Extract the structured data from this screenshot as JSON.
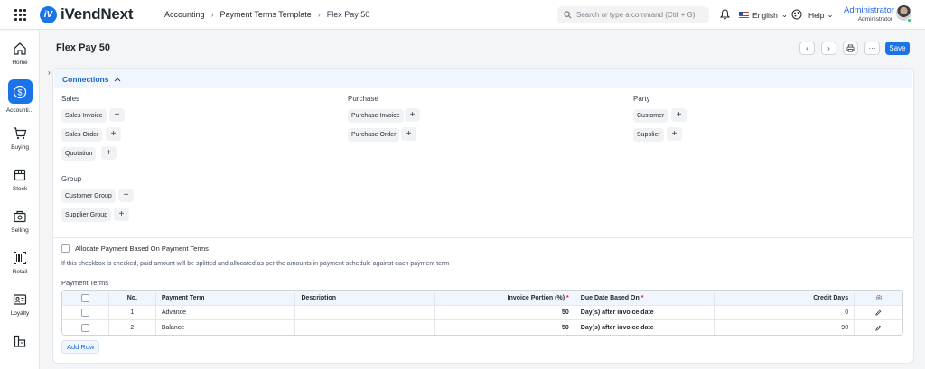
{
  "app": {
    "logo_mark": "iV",
    "name": "iVendNext"
  },
  "breadcrumb": [
    "Accounting",
    "Payment Terms Template",
    "Flex Pay 50"
  ],
  "search": {
    "placeholder": "Search or type a command (Ctrl + G)"
  },
  "language": "English",
  "help": "Help",
  "user": {
    "name": "Administrator",
    "role": "Administrator"
  },
  "sidebar": {
    "items": [
      {
        "label": "Home",
        "icon": "home-icon"
      },
      {
        "label": "Accounti...",
        "icon": "dollar-icon",
        "active": true
      },
      {
        "label": "Buying",
        "icon": "cart-icon"
      },
      {
        "label": "Stock",
        "icon": "box-icon"
      },
      {
        "label": "Selling",
        "icon": "selling-icon"
      },
      {
        "label": "Retail",
        "icon": "barcode-icon"
      },
      {
        "label": "Loyalty",
        "icon": "id-card-icon"
      },
      {
        "label": "",
        "icon": "building-icon"
      }
    ]
  },
  "page": {
    "title": "Flex Pay 50",
    "save_label": "Save",
    "more_label": "···"
  },
  "connections": {
    "title": "Connections",
    "groups": [
      {
        "label": "Sales",
        "items": [
          "Sales Invoice",
          "Sales Order",
          "Quotation"
        ]
      },
      {
        "label": "Purchase",
        "items": [
          "Purchase Invoice",
          "Purchase Order"
        ]
      },
      {
        "label": "Party",
        "items": [
          "Customer",
          "Supplier"
        ]
      },
      {
        "label": "Group",
        "items": [
          "Customer Group",
          "Supplier Group"
        ]
      }
    ]
  },
  "allocate": {
    "label": "Allocate Payment Based On Payment Terms",
    "description": "If this checkbox is checked, paid amount will be splitted and allocated as per the amounts in payment schedule against each payment term"
  },
  "payment_terms": {
    "label": "Payment Terms",
    "columns": [
      "No.",
      "Payment Term",
      "Description",
      "Invoice Portion (%)",
      "Due Date Based On",
      "Credit Days"
    ],
    "rows": [
      {
        "no": "1",
        "term": "Advance",
        "description": "",
        "portion": "50",
        "due": "Day(s) after invoice date",
        "credit_days": "0"
      },
      {
        "no": "2",
        "term": "Balance",
        "description": "",
        "portion": "50",
        "due": "Day(s) after invoice date",
        "credit_days": "90"
      }
    ],
    "add_row_label": "Add Row"
  },
  "colors": {
    "accent": "#1a73e8",
    "link": "#1a66d2",
    "section_bg": "#f0f6fe"
  }
}
